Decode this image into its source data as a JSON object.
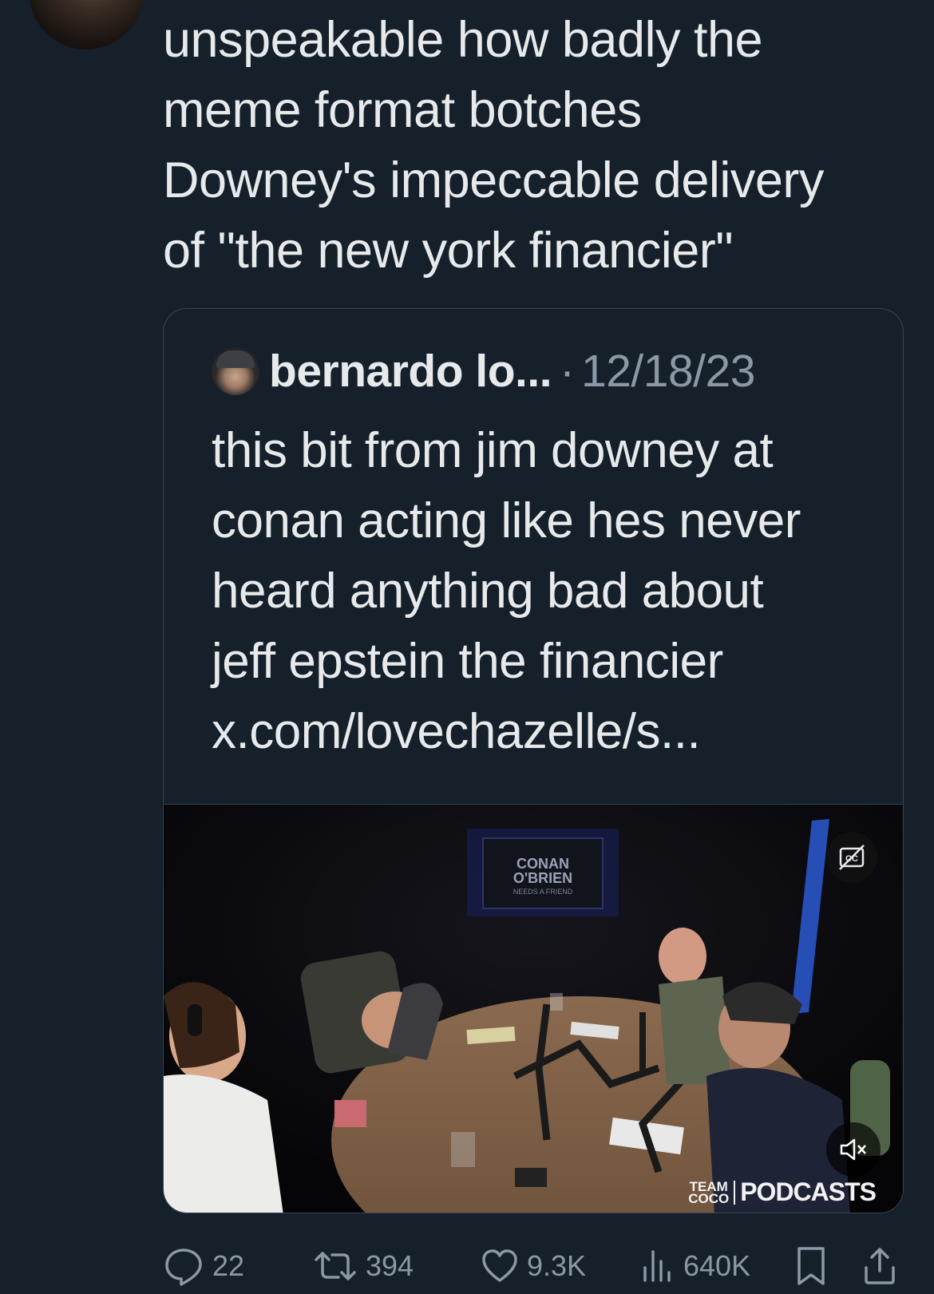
{
  "tweet": {
    "text": "unspeakable how badly the\nmeme format botches\nDowney's impeccable delivery\nof \"the new york financier\""
  },
  "quote": {
    "author": "bernardo lo...",
    "separator": "·",
    "date": "12/18/23",
    "text": "this bit from jim downey at\nconan acting like hes never\nheard anything bad about\njeff epstein the financier\nx.com/lovechazelle/s...",
    "video": {
      "sign_line1": "CONAN",
      "sign_line2": "O'BRIEN",
      "sign_line3": "NEEDS A FRIEND",
      "watermark_team": "TEAM\nCOCO",
      "watermark_podcasts": "PODCASTS",
      "captions_icon": "captions-off-icon",
      "mute_icon": "speaker-muted-icon"
    }
  },
  "actions": {
    "replies": "22",
    "reposts": "394",
    "likes": "9.3K",
    "views": "640K"
  },
  "colors": {
    "background": "#15202b",
    "text": "#e7e9ea",
    "secondary": "#8b98a5",
    "border": "#38444d"
  }
}
